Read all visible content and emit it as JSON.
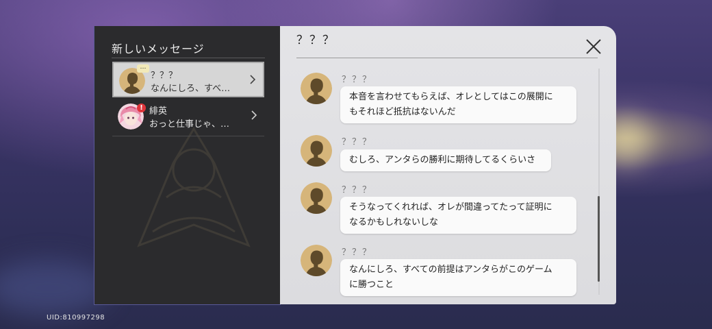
{
  "uid": "UID:810997298",
  "messages_panel": {
    "title": "新しいメッセージ"
  },
  "contacts": [
    {
      "name": "？？？",
      "preview": "なんにしろ、すべ…",
      "selected": true,
      "badge": "…"
    },
    {
      "name": "緋英",
      "preview": "おっと仕事じゃ、…",
      "selected": false,
      "badge": "!"
    }
  ],
  "chat": {
    "title": "？？？",
    "messages": [
      {
        "sender": "？？？",
        "lines": [
          "本音を言わせてもらえば、オレとしてはこの展開に",
          "もそれほど抵抗はないんだ"
        ]
      },
      {
        "sender": "？？？",
        "lines": [
          "むしろ、アンタらの勝利に期待してるくらいさ"
        ]
      },
      {
        "sender": "？？？",
        "lines": [
          "そうなってくれれば、オレが間違ってたって証明に",
          "なるかもしれないしな"
        ]
      },
      {
        "sender": "？？？",
        "lines": [
          "なんにしろ、すべての前提はアンタらがこのゲーム",
          "に勝つこと"
        ]
      }
    ]
  },
  "icons": {
    "close": "close-icon",
    "chevron": "chevron-right-icon",
    "avatar_unknown": "silhouette-avatar-icon",
    "avatar_hiei": "character-portrait"
  },
  "colors": {
    "left_panel": "#2b2b2d",
    "right_panel": "#e2e2e5",
    "avatar_bg": "#d6b57a",
    "silhouette": "#5e4a2a",
    "alert": "#e0353b"
  }
}
